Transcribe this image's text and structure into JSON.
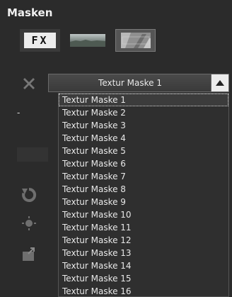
{
  "panel": {
    "title": "Masken"
  },
  "mask_types": [
    {
      "label": "FX",
      "icon": "fx-icon"
    },
    {
      "label": "",
      "icon": "gradient-mask-icon"
    },
    {
      "label": "",
      "icon": "texture-mask-icon",
      "active": true
    }
  ],
  "dash_text": "-",
  "texture_select": {
    "value": "Textur Maske 1",
    "icon": "triangle-up-icon",
    "options": [
      "Textur Maske 1",
      "Textur Maske 2",
      "Textur Maske 3",
      "Textur Maske 4",
      "Textur Maske 5",
      "Textur Maske 6",
      "Textur Maske 7",
      "Textur Maske 8",
      "Textur Maske 9",
      "Textur Maske 10",
      "Textur Maske 11",
      "Textur Maske 12",
      "Textur Maske 13",
      "Textur Maske 14",
      "Textur Maske 15",
      "Textur Maske 16"
    ],
    "selected_index": 0
  },
  "side_tools": [
    "remove-icon",
    "reset-icon",
    "sun-icon",
    "export-icon"
  ],
  "colors": {
    "background": "#2b2b2b",
    "accent": "#ececec"
  }
}
